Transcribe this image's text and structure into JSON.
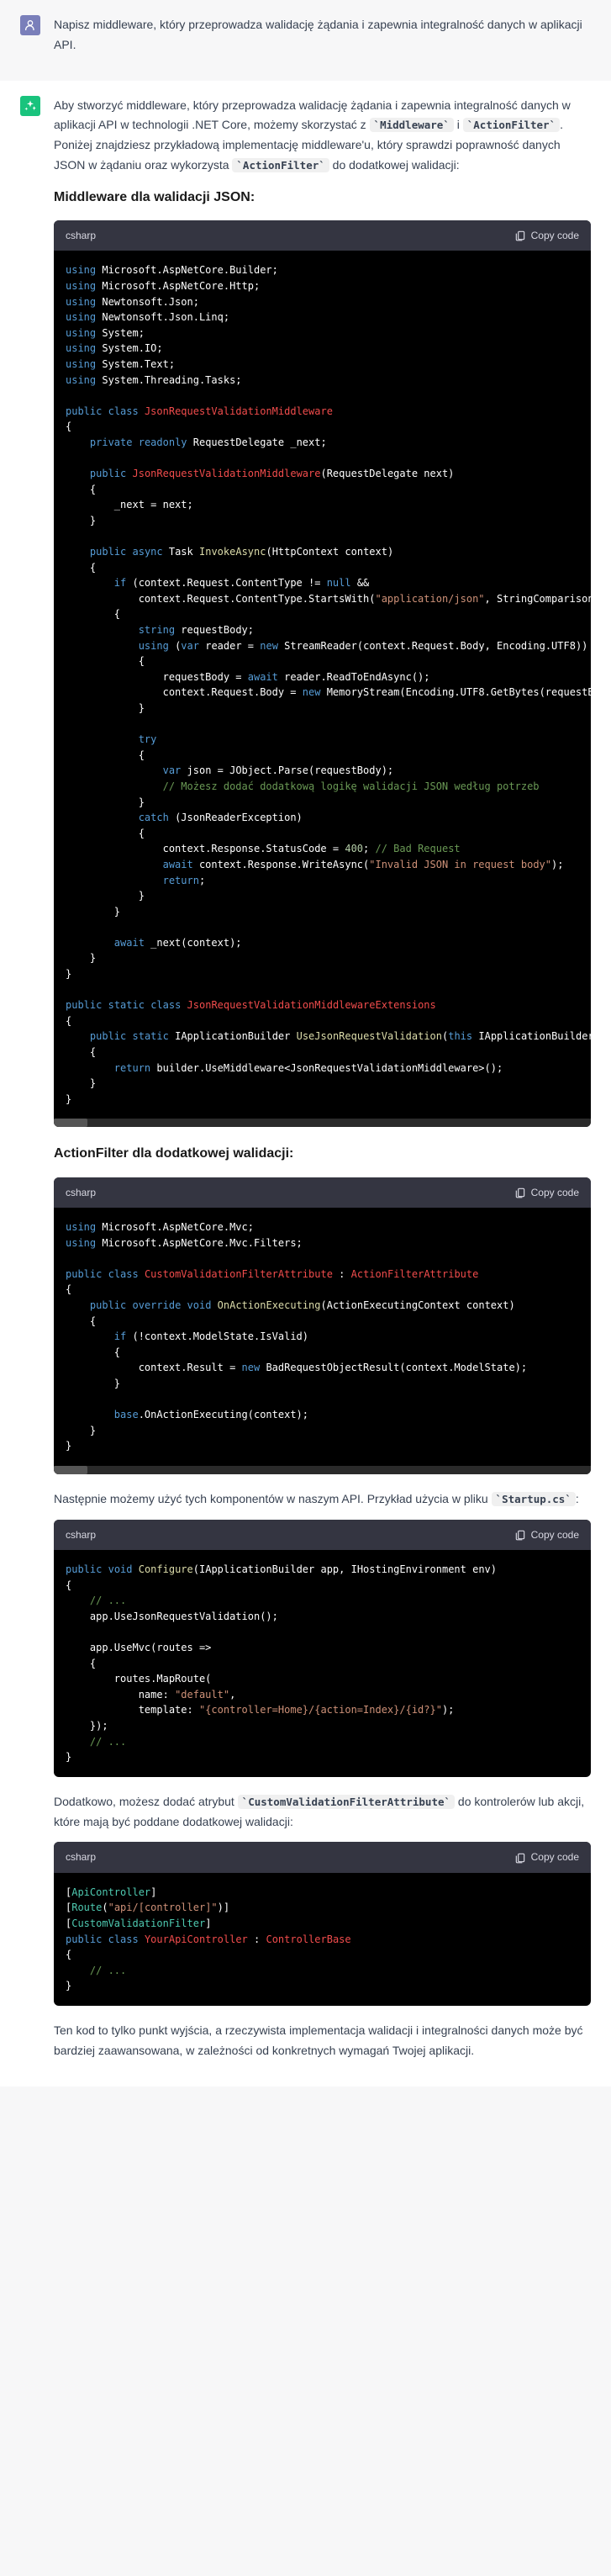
{
  "user": {
    "prompt": "Napisz middleware, który przeprowadza walidację żądania i zapewnia integralność danych w aplikacji API."
  },
  "assistant": {
    "intro_part1": "Aby stworzyć middleware, który przeprowadza walidację żądania i zapewnia integralność danych w aplikacji API w technologii .NET Core, możemy skorzystać z ",
    "intro_code1": "`Middleware`",
    "intro_and": " i ",
    "intro_code2": "`ActionFilter`",
    "intro_part2": ". Poniżej znajdziesz przykładową implementację middleware'u, który sprawdzi poprawność danych JSON w żądaniu oraz wykorzysta ",
    "intro_code3": "`ActionFilter`",
    "intro_part3": " do dodatkowej walidacji:",
    "heading1": "Middleware dla walidacji JSON:",
    "heading2": "ActionFilter dla dodatkowej walidacji:",
    "para2_part1": "Następnie możemy użyć tych komponentów w naszym API. Przykład użycia w pliku ",
    "para2_code": "`Startup.cs`",
    "para2_part2": ":",
    "para3_part1": "Dodatkowo, możesz dodać atrybut ",
    "para3_code": "`CustomValidationFilterAttribute`",
    "para3_part2": " do kontrolerów lub akcji, które mają być poddane dodatkowej walidacji:",
    "outro": "Ten kod to tylko punkt wyjścia, a rzeczywista implementacja walidacji i integralności danych może być bardziej zaawansowana, w zależności od konkretnych wymagań Twojej aplikacji."
  },
  "codeblocks": {
    "lang": "csharp",
    "copy": "Copy code"
  }
}
